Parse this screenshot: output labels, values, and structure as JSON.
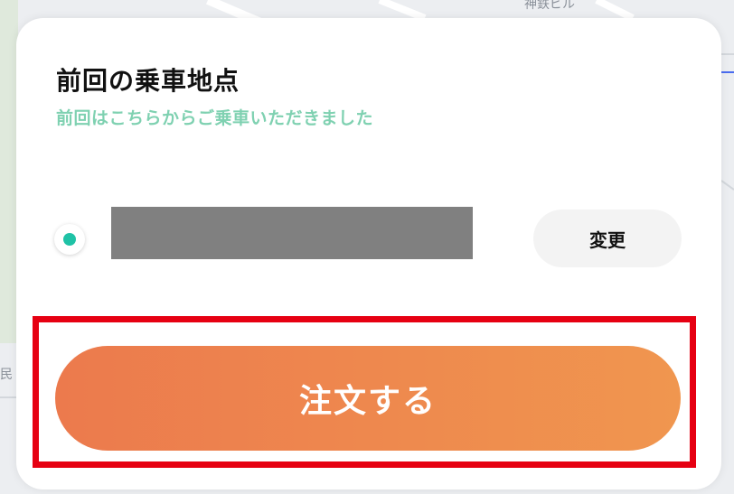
{
  "map": {
    "label_top": "神鉄ビル",
    "label_left": "民"
  },
  "card": {
    "title": "前回の乗車地点",
    "subtitle": "前回はこちらからご乗車いただきました"
  },
  "pickup": {
    "address_redacted": "",
    "change_label": "変更"
  },
  "order": {
    "button_label": "注文する",
    "button_gradient": [
      "#ec7a4d",
      "#f0964f"
    ]
  },
  "colors": {
    "subtitle": "#7fd1b1",
    "dot": "#1fc2a6",
    "highlight": "#e60012"
  }
}
